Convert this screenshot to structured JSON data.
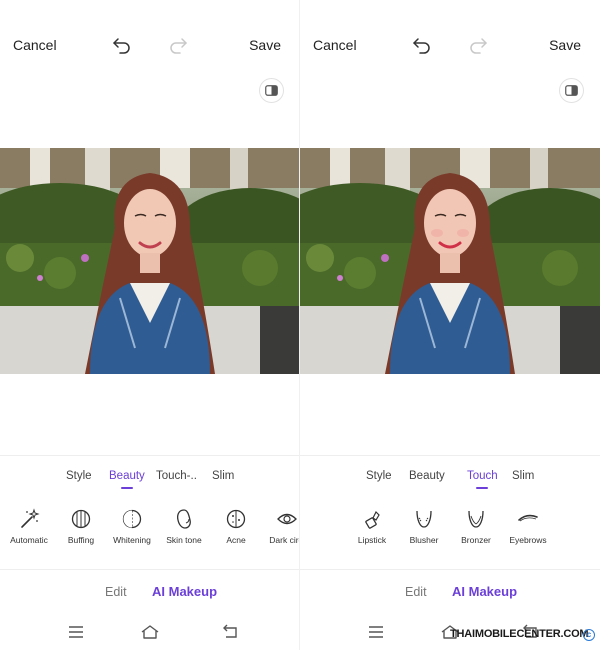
{
  "left_panel": {
    "topbar": {
      "cancel_label": "Cancel",
      "save_label": "Save"
    },
    "tabs": [
      {
        "label": "Style",
        "active": false
      },
      {
        "label": "Beauty",
        "active": true
      },
      {
        "label": "Touch-..",
        "active": false
      },
      {
        "label": "Slim",
        "active": false
      }
    ],
    "tools": [
      {
        "label": "Automatic",
        "icon": "magic-wand-icon"
      },
      {
        "label": "Buffing",
        "icon": "buffing-icon"
      },
      {
        "label": "Whitening",
        "icon": "whitening-icon"
      },
      {
        "label": "Skin tone",
        "icon": "skin-tone-icon"
      },
      {
        "label": "Acne",
        "icon": "acne-icon"
      },
      {
        "label": "Dark circl",
        "icon": "eye-icon"
      }
    ],
    "modes": {
      "edit_label": "Edit",
      "ai_label": "AI Makeup"
    }
  },
  "right_panel": {
    "topbar": {
      "cancel_label": "Cancel",
      "save_label": "Save"
    },
    "tabs": [
      {
        "label": "Style",
        "active": false
      },
      {
        "label": "Beauty",
        "active": false
      },
      {
        "label": "Touch",
        "active": true
      },
      {
        "label": "Slim",
        "active": false
      }
    ],
    "tools": [
      {
        "label": "Lipstick",
        "icon": "lipstick-icon"
      },
      {
        "label": "Blusher",
        "icon": "blusher-icon"
      },
      {
        "label": "Bronzer",
        "icon": "bronzer-icon"
      },
      {
        "label": "Eyebrows",
        "icon": "eyebrow-icon"
      }
    ],
    "modes": {
      "edit_label": "Edit",
      "ai_label": "AI Makeup"
    }
  },
  "watermark": {
    "text": "THAIMOBILECENTER.COM",
    "copyright_symbol": "c"
  },
  "colors": {
    "accent": "#6b3fd8",
    "text": "#222222",
    "muted": "#777777",
    "divider": "#eeeeee"
  }
}
